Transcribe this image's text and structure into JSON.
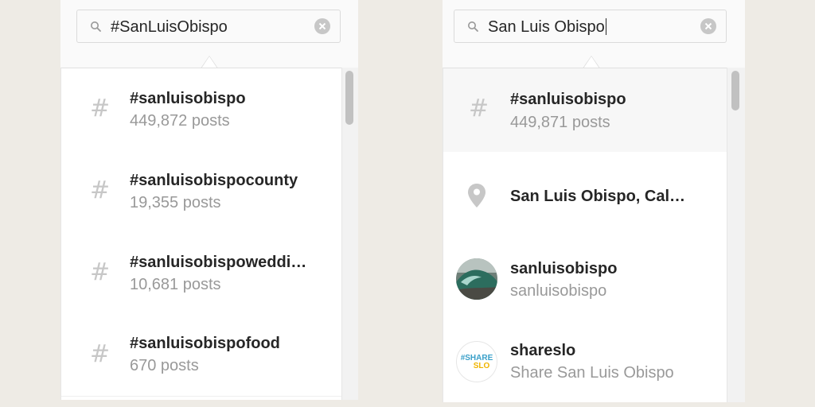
{
  "left": {
    "search": {
      "value": "#SanLuisObispo"
    },
    "results": [
      {
        "icon": "hash-icon",
        "title": "#sanluisobispo",
        "subtitle": "449,872 posts"
      },
      {
        "icon": "hash-icon",
        "title": "#sanluisobispocounty",
        "subtitle": "19,355 posts"
      },
      {
        "icon": "hash-icon",
        "title": "#sanluisobispoweddi…",
        "subtitle": "10,681 posts"
      },
      {
        "icon": "hash-icon",
        "title": "#sanluisobispofood",
        "subtitle": "670 posts"
      }
    ]
  },
  "right": {
    "search": {
      "value": "San Luis Obispo"
    },
    "results": [
      {
        "icon": "hash-icon",
        "title": "#sanluisobispo",
        "subtitle": "449,871 posts"
      },
      {
        "icon": "location-pin-icon",
        "title": "San Luis Obispo, Cal…"
      },
      {
        "icon": "wave-avatar",
        "title": "sanluisobispo",
        "subtitle": "sanluisobispo"
      },
      {
        "icon": "shareslo-avatar",
        "title": "shareslo",
        "subtitle": "Share San Luis Obispo",
        "avatar_text": [
          "#SHARE",
          "SLO"
        ]
      }
    ]
  },
  "colors": {
    "background": "#eeebe5",
    "border": "#dbdbdb",
    "title_text": "#262626",
    "subtitle_text": "#999999",
    "hash_icon": "#c7c7c7"
  }
}
